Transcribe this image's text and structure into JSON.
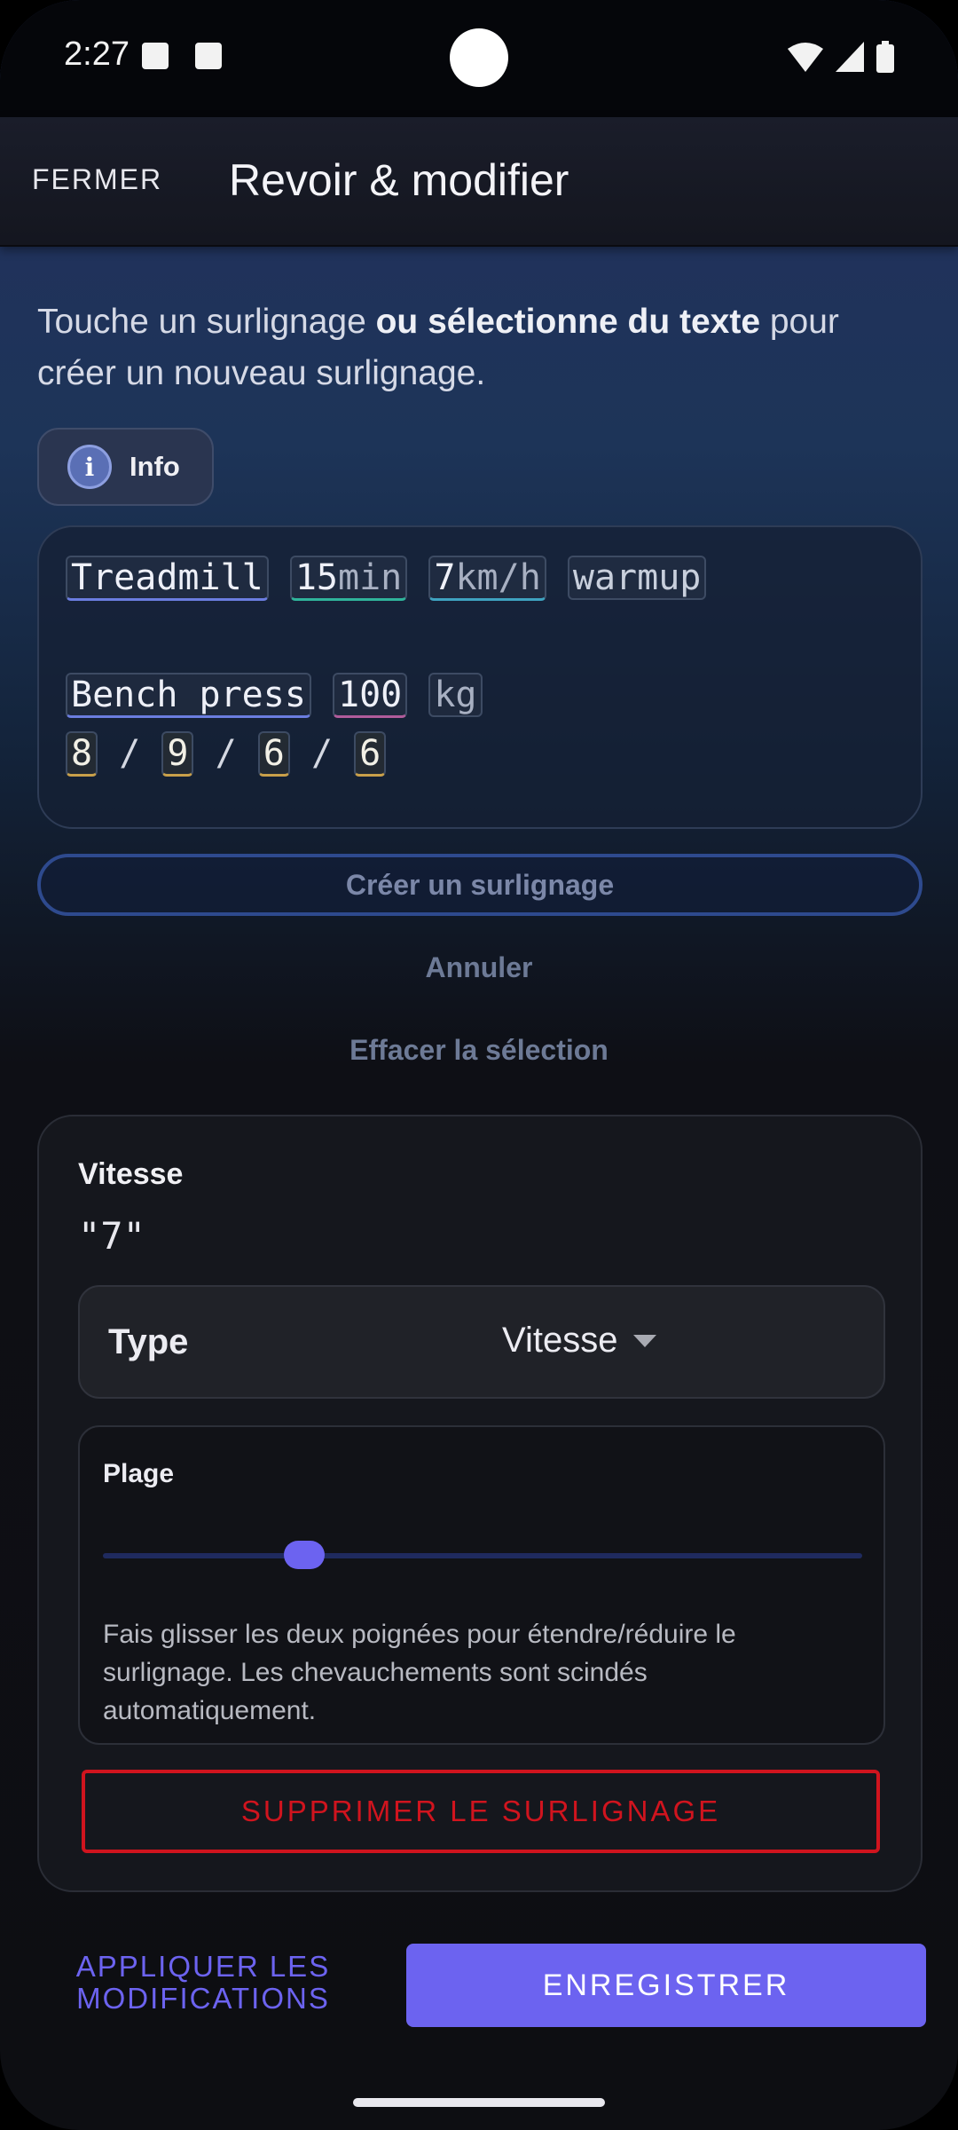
{
  "status_bar": {
    "time": "2:27"
  },
  "header": {
    "close_label": "FERMER",
    "title": "Revoir & modifier"
  },
  "instructions": {
    "part1": "Touche un surlignage ",
    "bold": "ou sélectionne du texte",
    "part2": " pour créer un nouveau surlignage."
  },
  "info": {
    "icon_letter": "i",
    "label": "Info"
  },
  "text_lines": {
    "l1": {
      "exercise": "Treadmill",
      "duration_num": "15",
      "duration_unit": "min",
      "speed_num": "7",
      "speed_unit": "km/h",
      "note": "warmup"
    },
    "l2": {
      "exercise": "Bench press",
      "weight": "100",
      "unit": "kg"
    },
    "l3": {
      "r1": "8",
      "r2": "9",
      "r3": "6",
      "r4": "6",
      "sep": "/"
    }
  },
  "actions": {
    "create": "Créer un surlignage",
    "cancel": "Annuler",
    "clear": "Effacer la sélection"
  },
  "detail": {
    "title": "Vitesse",
    "value": "\"7\"",
    "type_label": "Type",
    "type_value": "Vitesse",
    "range_label": "Plage",
    "range_position": 0.265,
    "range_help": "Fais glisser les deux poignées pour étendre/réduire le surlignage. Les chevauchements sont scindés automatiquement.",
    "delete": "SUPPRIMER LE SURLIGNAGE"
  },
  "footer": {
    "apply": "APPLIQUER LES MODIFICATIONS",
    "save": "ENREGISTRER"
  },
  "colors": {
    "accent": "#6c63f0",
    "danger": "#d0141e"
  }
}
